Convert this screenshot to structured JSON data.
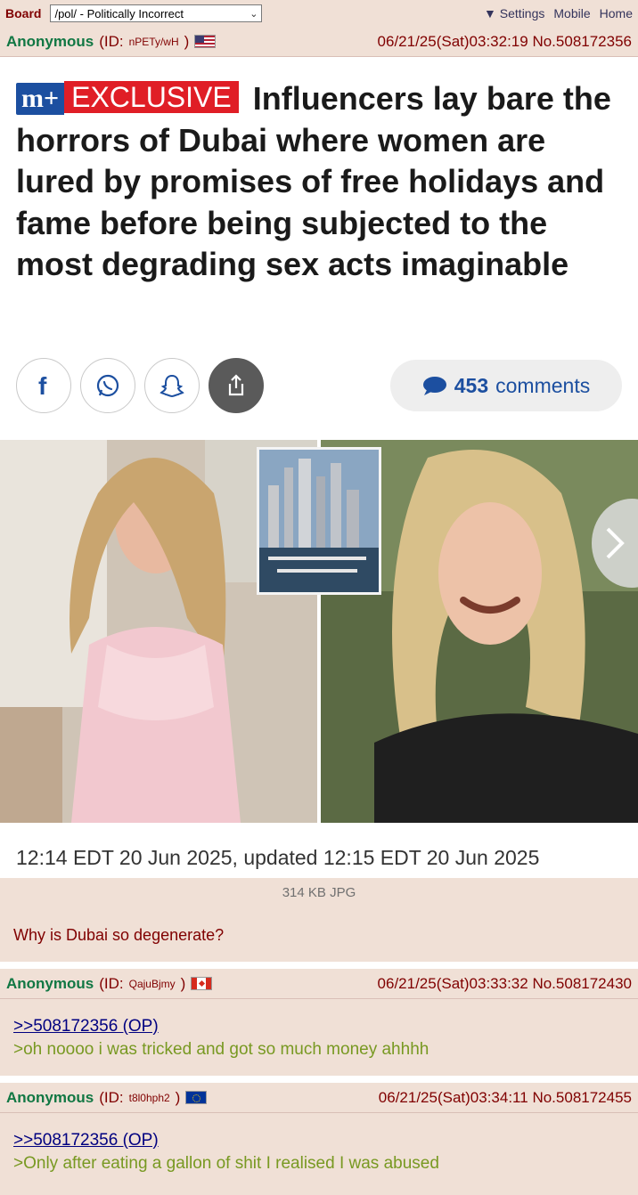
{
  "topbar": {
    "board_label": "Board",
    "board_select": "/pol/ - Politically Incorrect",
    "settings": "Settings",
    "mobile": "Mobile",
    "home": "Home"
  },
  "op": {
    "name": "Anonymous",
    "id_open": "(ID:",
    "id": "nPETy/wH",
    "id_close": ")",
    "flag": "us-flag-icon",
    "datetime": "06/21/25(Sat)03:32:19",
    "no": "No.508172356",
    "file_info": "314 KB JPG",
    "comment": "Why is Dubai so degenerate?"
  },
  "article": {
    "badge_m": "m+",
    "badge_exclusive": "EXCLUSIVE",
    "headline": "Influencers lay bare the horrors of Dubai where women are lured by promises of free holidays and fame before being subjected to the most degrading sex acts imaginable",
    "comments_count": "453",
    "comments_label": "comments",
    "timestamp": "12:14 EDT 20 Jun 2025, updated 12:15 EDT 20 Jun 2025"
  },
  "replies": [
    {
      "name": "Anonymous",
      "id": "QajuBjmy",
      "flag": "canada-flag-icon",
      "datetime": "06/21/25(Sat)03:33:32",
      "no": "No.508172430",
      "quote": ">>508172356 (OP)",
      "text": ">oh noooo i was tricked and got so much money ahhhh"
    },
    {
      "name": "Anonymous",
      "id": "t8l0hph2",
      "flag": "eu-flag-icon",
      "datetime": "06/21/25(Sat)03:34:11",
      "no": "No.508172455",
      "quote": ">>508172356 (OP)",
      "text": ">Only after eating a gallon of shit I realised I was abused"
    }
  ],
  "colors": {
    "post_bg": "#f0e0d6",
    "name": "#117743",
    "maroon": "#800000",
    "link": "#000080",
    "greentext": "#789922"
  }
}
